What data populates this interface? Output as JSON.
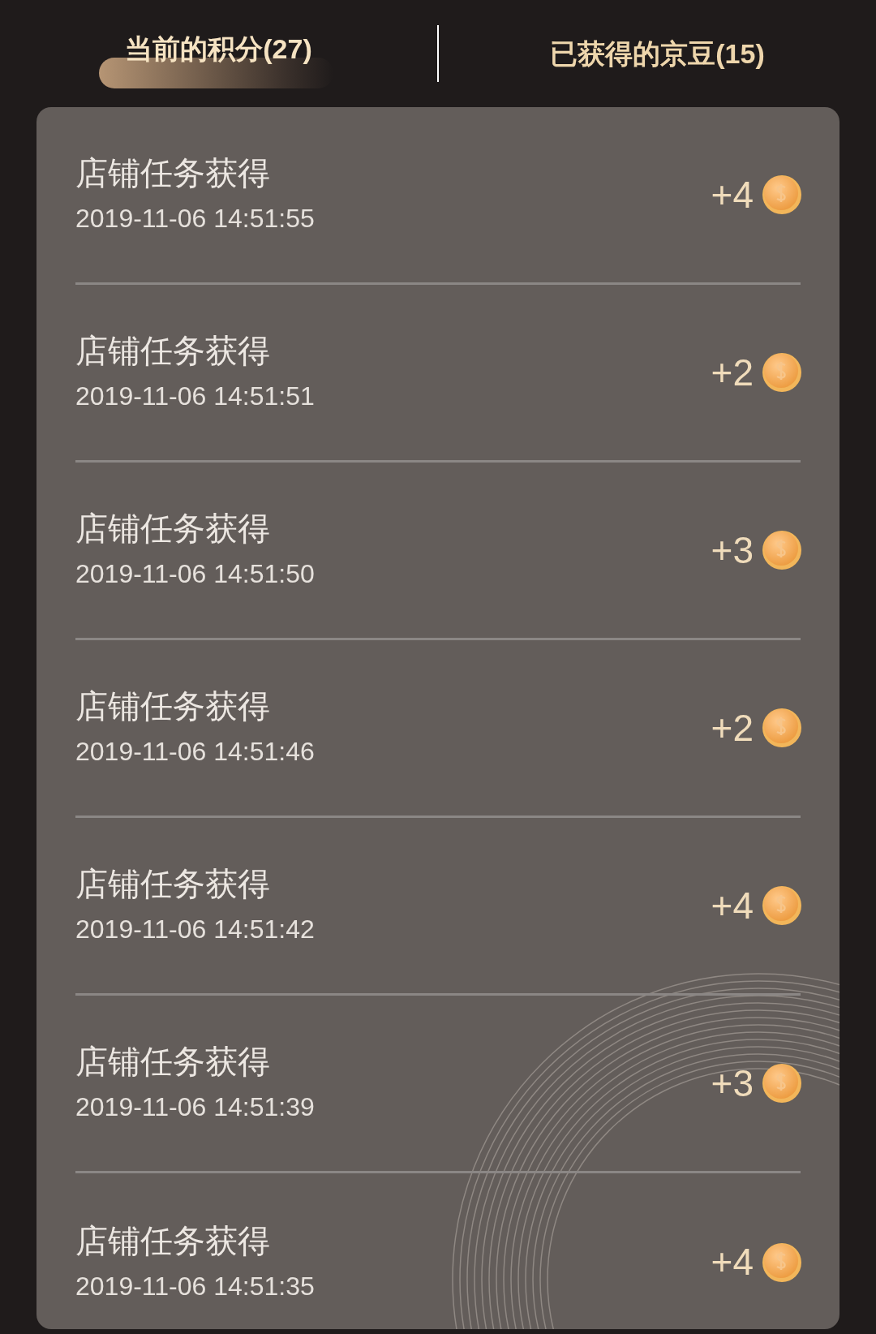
{
  "tabs": [
    {
      "label": "当前的积分(27)",
      "selected": true
    },
    {
      "label": "已获得的京豆(15)",
      "selected": false
    }
  ],
  "records": [
    {
      "title": "店铺任务获得",
      "time": "2019-11-06 14:51:55",
      "amount": "+4"
    },
    {
      "title": "店铺任务获得",
      "time": "2019-11-06 14:51:51",
      "amount": "+2"
    },
    {
      "title": "店铺任务获得",
      "time": "2019-11-06 14:51:50",
      "amount": "+3"
    },
    {
      "title": "店铺任务获得",
      "time": "2019-11-06 14:51:46",
      "amount": "+2"
    },
    {
      "title": "店铺任务获得",
      "time": "2019-11-06 14:51:42",
      "amount": "+4"
    },
    {
      "title": "店铺任务获得",
      "time": "2019-11-06 14:51:39",
      "amount": "+3"
    },
    {
      "title": "店铺任务获得",
      "time": "2019-11-06 14:51:35",
      "amount": "+4"
    }
  ]
}
